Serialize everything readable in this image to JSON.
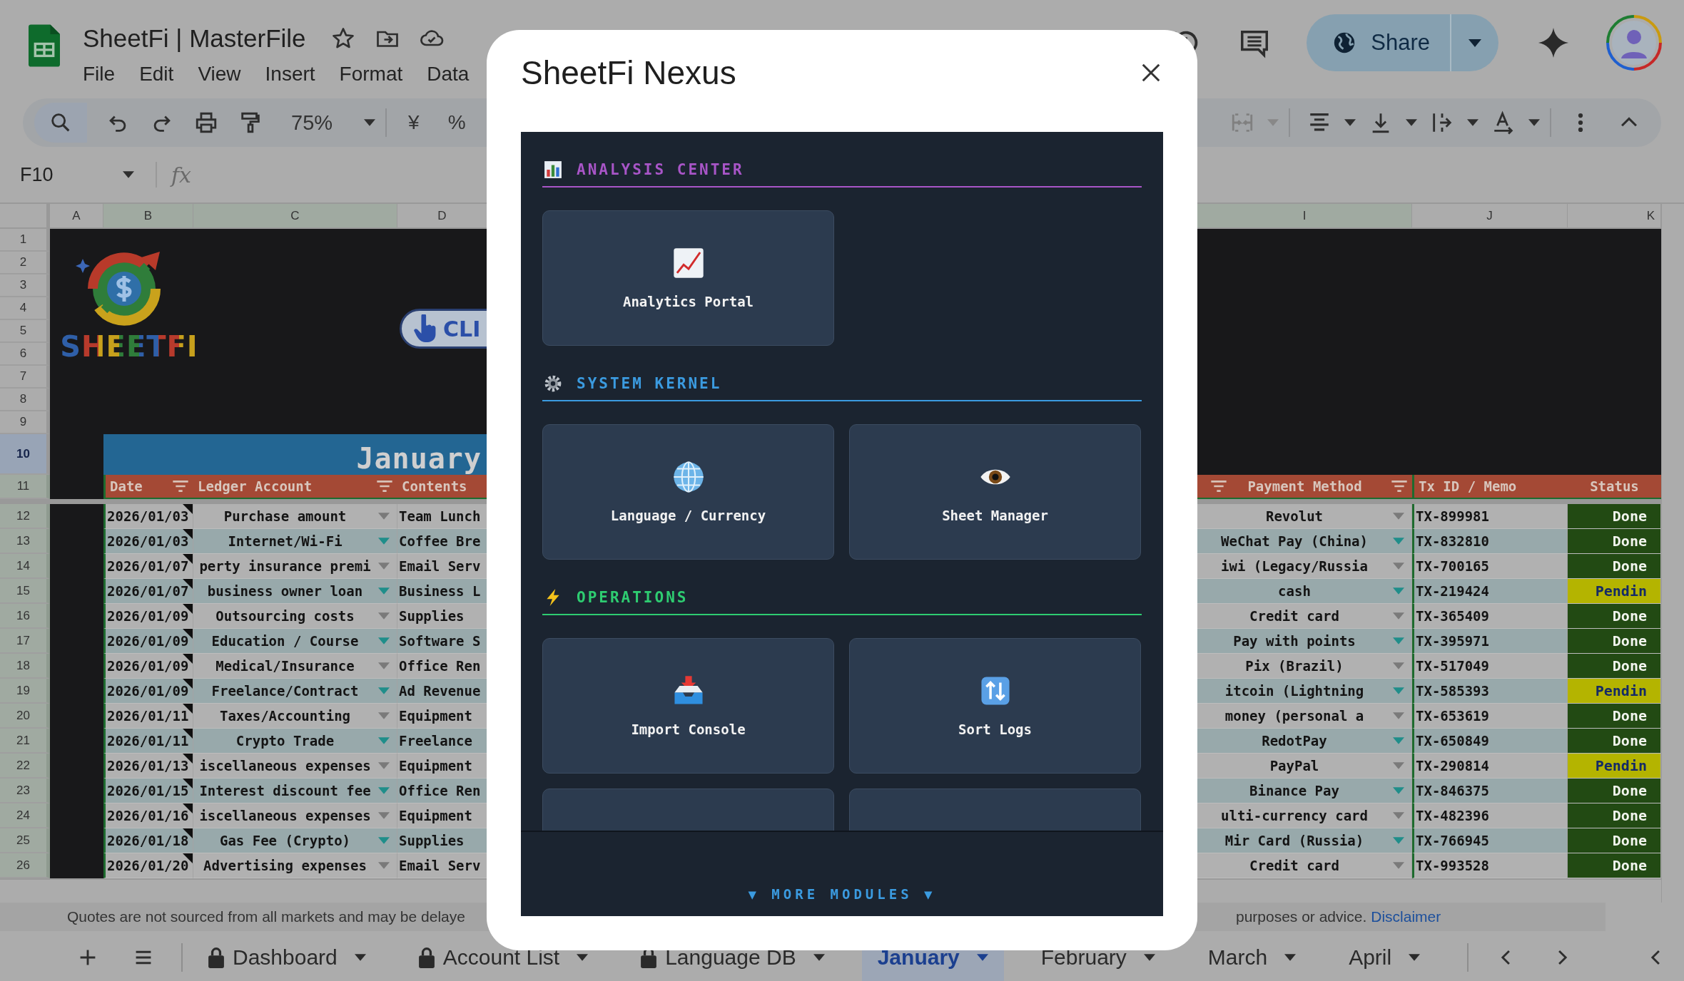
{
  "document": {
    "title": "SheetFi | MasterFile"
  },
  "menu": [
    "File",
    "Edit",
    "View",
    "Insert",
    "Format",
    "Data"
  ],
  "share": {
    "label": "Share"
  },
  "toolbar": {
    "zoom": "75%",
    "currency": "¥",
    "percent": "%"
  },
  "formula_bar": {
    "name_box": "F10",
    "fx": "fx"
  },
  "column_headers": [
    {
      "label": "A",
      "selected": false
    },
    {
      "label": "B",
      "selected": true
    },
    {
      "label": "C",
      "selected": true
    },
    {
      "label": "D",
      "selected": false
    },
    {
      "label": "I",
      "selected": true
    },
    {
      "label": "J",
      "selected": false
    },
    {
      "label": "K",
      "selected": false
    }
  ],
  "row_headers": [
    {
      "label": "1",
      "highlighted": false,
      "active": false
    },
    {
      "label": "2",
      "highlighted": false,
      "active": false
    },
    {
      "label": "3",
      "highlighted": false,
      "active": false
    },
    {
      "label": "4",
      "highlighted": false,
      "active": false
    },
    {
      "label": "5",
      "highlighted": false,
      "active": false
    },
    {
      "label": "6",
      "highlighted": false,
      "active": false
    },
    {
      "label": "7",
      "highlighted": false,
      "active": false
    },
    {
      "label": "8",
      "highlighted": false,
      "active": false
    },
    {
      "label": "9",
      "highlighted": false,
      "active": false
    },
    {
      "label": "10",
      "highlighted": false,
      "active": true
    },
    {
      "label": "11",
      "highlighted": true,
      "active": false
    },
    {
      "label": "12",
      "highlighted": true,
      "active": false
    },
    {
      "label": "13",
      "highlighted": true,
      "active": false
    },
    {
      "label": "14",
      "highlighted": true,
      "active": false
    },
    {
      "label": "15",
      "highlighted": true,
      "active": false
    },
    {
      "label": "16",
      "highlighted": true,
      "active": false
    },
    {
      "label": "17",
      "highlighted": true,
      "active": false
    },
    {
      "label": "18",
      "highlighted": true,
      "active": false
    },
    {
      "label": "19",
      "highlighted": true,
      "active": false
    },
    {
      "label": "20",
      "highlighted": true,
      "active": false
    },
    {
      "label": "21",
      "highlighted": true,
      "active": false
    },
    {
      "label": "22",
      "highlighted": true,
      "active": false
    },
    {
      "label": "23",
      "highlighted": true,
      "active": false
    },
    {
      "label": "24",
      "highlighted": true,
      "active": false
    },
    {
      "label": "25",
      "highlighted": true,
      "active": false
    },
    {
      "label": "26",
      "highlighted": true,
      "active": false
    }
  ],
  "logo": {
    "text": "SHEETFI"
  },
  "click_badge": {
    "text": "CLI"
  },
  "banner": {
    "title": "January"
  },
  "table_header": [
    "Date",
    "Ledger Account",
    "Contents",
    "Payment Method",
    "Tx ID / Memo",
    "Status"
  ],
  "rows": [
    {
      "date": "2026/01/03",
      "account": "Purchase amount",
      "contents": "Team Lunch",
      "payment": "Revolut",
      "tx": "TX-899981",
      "status": "Done",
      "pending": false
    },
    {
      "date": "2026/01/03",
      "account": "Internet/Wi-Fi",
      "contents": "Coffee Bre",
      "payment": "WeChat Pay (China)",
      "tx": "TX-832810",
      "status": "Done",
      "pending": false
    },
    {
      "date": "2026/01/07",
      "account": "perty insurance premi",
      "contents": "Email Serv",
      "payment": "iwi (Legacy/Russia",
      "tx": "TX-700165",
      "status": "Done",
      "pending": false
    },
    {
      "date": "2026/01/07",
      "account": "business owner loan",
      "contents": "Business L",
      "payment": "cash",
      "tx": "TX-219424",
      "status": "Pendin",
      "pending": true
    },
    {
      "date": "2026/01/09",
      "account": "Outsourcing costs",
      "contents": "Supplies",
      "payment": "Credit card",
      "tx": "TX-365409",
      "status": "Done",
      "pending": false
    },
    {
      "date": "2026/01/09",
      "account": "Education / Course",
      "contents": "Software S",
      "payment": "Pay with points",
      "tx": "TX-395971",
      "status": "Done",
      "pending": false
    },
    {
      "date": "2026/01/09",
      "account": "Medical/Insurance",
      "contents": "Office Ren",
      "payment": "Pix (Brazil)",
      "tx": "TX-517049",
      "status": "Done",
      "pending": false
    },
    {
      "date": "2026/01/09",
      "account": "Freelance/Contract",
      "contents": "Ad Revenue",
      "payment": "itcoin (Lightning",
      "tx": "TX-585393",
      "status": "Pendin",
      "pending": true
    },
    {
      "date": "2026/01/11",
      "account": "Taxes/Accounting",
      "contents": "Equipment",
      "payment": "money (personal a",
      "tx": "TX-653619",
      "status": "Done",
      "pending": false
    },
    {
      "date": "2026/01/11",
      "account": "Crypto Trade",
      "contents": "Freelance",
      "payment": "RedotPay",
      "tx": "TX-650849",
      "status": "Done",
      "pending": false
    },
    {
      "date": "2026/01/13",
      "account": "iscellaneous expenses",
      "contents": "Equipment",
      "payment": "PayPal",
      "tx": "TX-290814",
      "status": "Pendin",
      "pending": true
    },
    {
      "date": "2026/01/15",
      "account": "Interest discount fee",
      "contents": "Office Ren",
      "payment": "Binance Pay",
      "tx": "TX-846375",
      "status": "Done",
      "pending": false
    },
    {
      "date": "2026/01/16",
      "account": "iscellaneous expenses",
      "contents": "Equipment",
      "payment": "ulti-currency card",
      "tx": "TX-482396",
      "status": "Done",
      "pending": false
    },
    {
      "date": "2026/01/18",
      "account": "Gas Fee (Crypto)",
      "contents": "Supplies",
      "payment": "Mir Card (Russia)",
      "tx": "TX-766945",
      "status": "Done",
      "pending": false
    },
    {
      "date": "2026/01/20",
      "account": "Advertising expenses",
      "contents": "Email Serv",
      "payment": "Credit card",
      "tx": "TX-993528",
      "status": "Done",
      "pending": false
    }
  ],
  "notice": {
    "left": "Quotes are not sourced from all markets and may be delaye",
    "right": "purposes or advice.",
    "link": "Disclaimer"
  },
  "sheet_tabs": [
    {
      "label": "Dashboard",
      "locked": true,
      "selected": false
    },
    {
      "label": "Account List",
      "locked": true,
      "selected": false
    },
    {
      "label": "Language DB",
      "locked": true,
      "selected": false
    },
    {
      "label": "January",
      "locked": false,
      "selected": true
    },
    {
      "label": "February",
      "locked": false,
      "selected": false
    },
    {
      "label": "March",
      "locked": false,
      "selected": false
    },
    {
      "label": "April",
      "locked": false,
      "selected": false
    }
  ],
  "dialog": {
    "title": "SheetFi Nexus",
    "sections": [
      {
        "title": "ANALYSIS CENTER",
        "color": "#a855c7",
        "cards": [
          {
            "kind": "module",
            "label": "Analytics Portal"
          }
        ]
      },
      {
        "title": "SYSTEM KERNEL",
        "color": "#3b9be0",
        "cards": [
          {
            "kind": "module",
            "label": "Language / Currency"
          },
          {
            "kind": "module",
            "label": "Sheet Manager"
          }
        ]
      },
      {
        "title": "OPERATIONS",
        "color": "#2ecc71",
        "cards": [
          {
            "kind": "module",
            "label": "Import Console"
          },
          {
            "kind": "module",
            "label": "Sort Logs"
          },
          {
            "kind": "partial"
          },
          {
            "kind": "partial"
          }
        ]
      }
    ],
    "more": "▼ MORE MODULES ▼"
  }
}
